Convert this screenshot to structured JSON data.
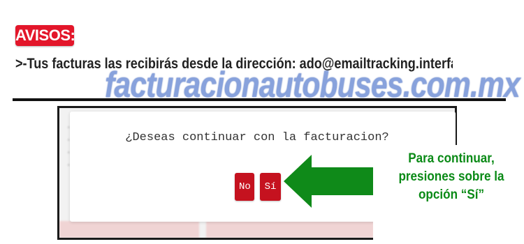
{
  "notice": {
    "badge_label": "AVISOS:",
    "message": ">-Tus facturas las recibirás desde la dirección: ado@emailtracking.interfactura.com.mx - Si tienes a"
  },
  "watermark": {
    "text": "facturacionautobuses.com.mx"
  },
  "dialog": {
    "question": "¿Deseas continuar con la facturacion?",
    "no_label": "No",
    "yes_label": "Sí"
  },
  "callout": {
    "text": "Para continuar, presiones sobre la opción “Sí”"
  },
  "colors": {
    "badge": "#e3162a",
    "button": "#c5121f",
    "arrow": "#0f8a19",
    "callout_text": "#0a8a16",
    "watermark": "#5b7fcf"
  }
}
